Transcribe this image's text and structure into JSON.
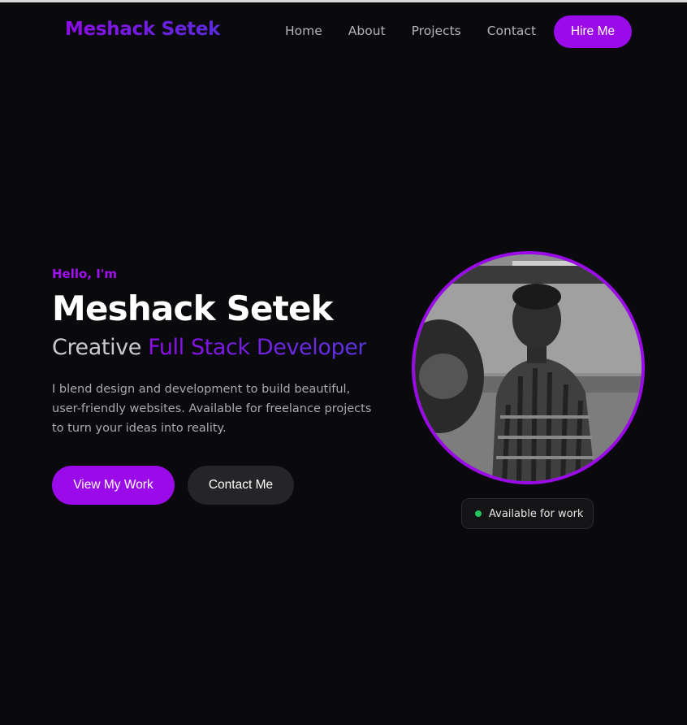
{
  "header": {
    "logo": "Meshack Setek",
    "nav": [
      {
        "label": "Home"
      },
      {
        "label": "About"
      },
      {
        "label": "Projects"
      },
      {
        "label": "Contact"
      }
    ],
    "cta_label": "Hire Me"
  },
  "hero": {
    "greeting": "Hello, I'm",
    "name": "Meshack Setek",
    "role_prefix": "Creative",
    "role_accent": "Full Stack Developer",
    "intro": "I blend design and development to build beautiful, user-friendly websites. Available for freelance projects to turn your ideas into reality.",
    "primary_button": "View My Work",
    "secondary_button": "Contact Me"
  },
  "profile": {
    "status_text": "Available for work"
  },
  "colors": {
    "background": "#0a0a0d",
    "accent": "#9b0ae8",
    "accent_secondary": "#5b34e0",
    "status_dot": "#22c55e",
    "secondary_button": "#252528"
  },
  "icons": {
    "status": "status-dot-icon"
  }
}
